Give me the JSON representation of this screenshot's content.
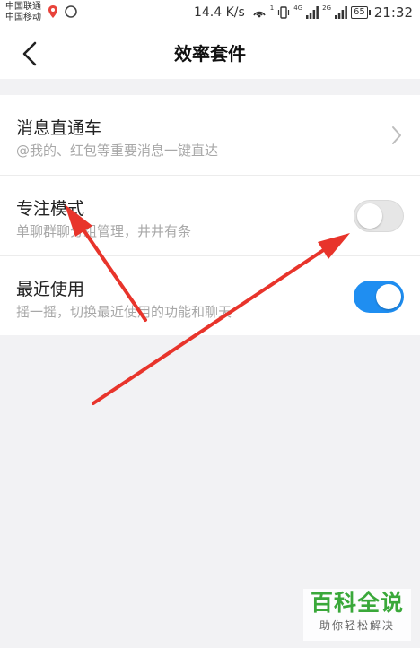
{
  "status_bar": {
    "carrier_1": "中国联通",
    "carrier_2": "中国移动",
    "speed": "14.4 K/s",
    "wifi_label": "1",
    "sig1_label": "4G",
    "sig2_label": "2G",
    "battery": "65",
    "time": "21:32"
  },
  "nav": {
    "title": "效率套件"
  },
  "rows": [
    {
      "title": "消息直通车",
      "subtitle": "@我的、红包等重要消息一键直达"
    },
    {
      "title": "专注模式",
      "subtitle": "单聊群聊分组管理，井井有条",
      "toggle_on": false
    },
    {
      "title": "最近使用",
      "subtitle": "摇一摇，切换最近使用的功能和聊天",
      "toggle_on": true
    }
  ],
  "colors": {
    "accent": "#1f8ef1",
    "toggle_off": "#e6e6e6",
    "arrow": "#e8342b",
    "watermark": "#3aa83a"
  },
  "watermark": {
    "main": "百科全说",
    "sub": "助你轻松解决"
  }
}
